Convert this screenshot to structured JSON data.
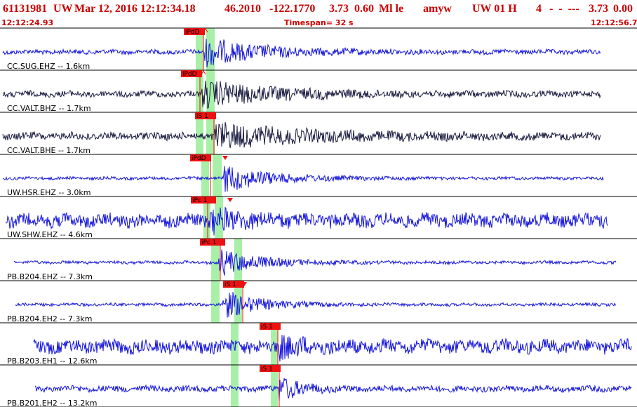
{
  "header": {
    "event_id": "61131981",
    "network": "UW",
    "datetime": "Mar 12, 2016 12:12:34.18",
    "lat": "46.2010",
    "lon": "-122.1770",
    "mag_a": "3.73",
    "mag_b": "0.60",
    "mag_type": "Ml le",
    "author": "amyw",
    "agency": "UW 01 H",
    "count": "4",
    "dashes": "-  -  ---",
    "mag_c": "3.73",
    "mag_d": "0.00"
  },
  "subheader": {
    "start_time": "12:12:24.93",
    "timespan": "Timespan=  32 s",
    "end_time": "12:12:56.72"
  },
  "colors": {
    "title_red": "#cc0000",
    "pick_red": "#ee1111",
    "green_band": "#a8f0a8",
    "trace_blue": "#1414dc",
    "trace_dark": "#1a1a40"
  },
  "traces": [
    {
      "label": "CC.SUG.EHZ -- 1.6km",
      "color_key": "trace_blue",
      "picks": [
        {
          "label": "iPdD",
          "marker": "caret-up"
        }
      ]
    },
    {
      "label": "CC.VALT.BHZ -- 1.7km",
      "color_key": "trace_dark",
      "picks": [
        {
          "label": "iPdD",
          "marker": "caret-up"
        }
      ]
    },
    {
      "label": "CC.VALT.BHE -- 1.7km",
      "color_key": "trace_dark",
      "picks": [
        {
          "label": "iS 1",
          "marker": "none"
        }
      ]
    },
    {
      "label": "UW.HSR.EHZ -- 3.0km",
      "color_key": "trace_blue",
      "picks": [
        {
          "label": "iPdD",
          "marker": "triangle-down"
        }
      ]
    },
    {
      "label": "UW.SHW.EHZ -- 4.6km",
      "color_key": "trace_blue",
      "picks": [
        {
          "label": "iPc 1",
          "marker": "triangle-down"
        }
      ]
    },
    {
      "label": "PB.B204.EHZ -- 7.3km",
      "color_key": "trace_blue",
      "picks": [
        {
          "label": "iPc 1",
          "marker": "none"
        }
      ]
    },
    {
      "label": "PB.B204.EH2 -- 7.3km",
      "color_key": "trace_blue",
      "picks": [
        {
          "label": "iS 1",
          "marker": "triangle-down"
        }
      ]
    },
    {
      "label": "PB.B203.EH1 -- 12.6km",
      "color_key": "trace_blue",
      "picks": [
        {
          "label": "iS 1",
          "marker": "none"
        }
      ]
    },
    {
      "label": "PB.B201.EH2 -- 13.2km",
      "color_key": "trace_blue",
      "picks": [
        {
          "label": "iS 1",
          "marker": "none"
        }
      ]
    }
  ]
}
